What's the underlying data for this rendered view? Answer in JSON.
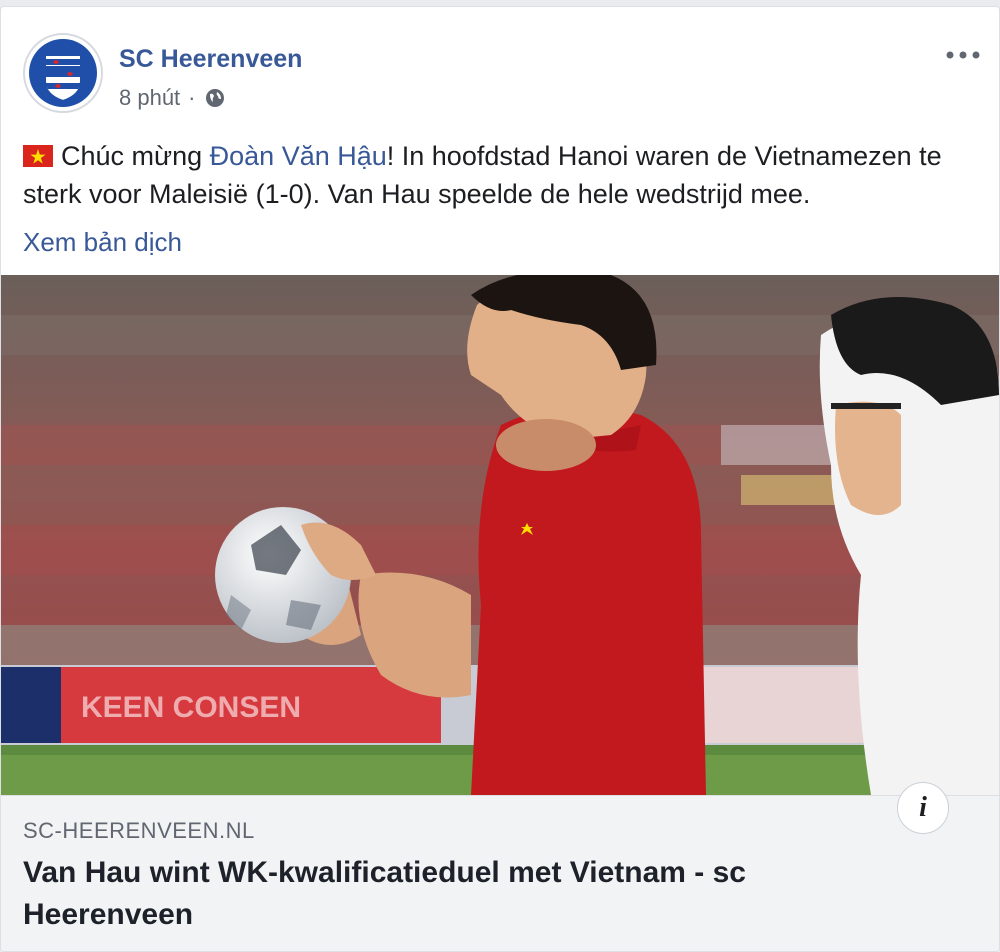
{
  "post": {
    "page_name": "SC Heerenveen",
    "time": "8 phút",
    "separator": "·",
    "privacy_icon": "globe-icon",
    "more_icon": "more-horizontal-icon",
    "text_prefix": "Chúc mừng ",
    "mention": "Đoàn Văn Hậu",
    "text_suffix": "! In hoofdstad Hanoi waren de Vietnamezen te sterk voor Maleisië (1-0). Van Hau speelde de hele wedstrijd mee.",
    "flag_icon": "vietnam-flag-icon",
    "translate_label": "Xem bản dịch"
  },
  "link_preview": {
    "domain": "SC-HEERENVEEN.NL",
    "title": "Van Hau wint WK-kwalificatieduel met Vietnam - sc Heerenveen",
    "info_label": "i",
    "image_icon": "football-player-photo"
  },
  "colors": {
    "link_blue": "#385898",
    "text": "#1c1e21",
    "muted": "#606770",
    "preview_bg": "#f2f3f5"
  }
}
